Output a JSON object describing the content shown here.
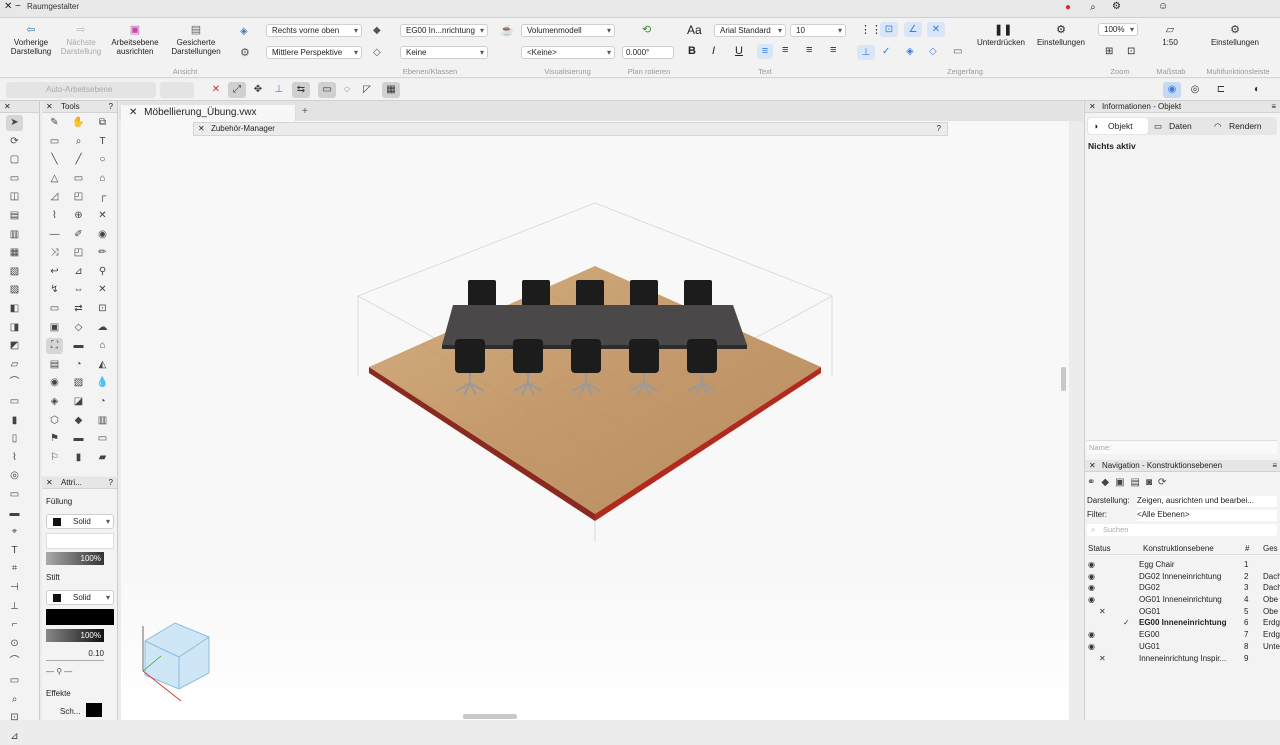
{
  "app_title": "Raumgestalter",
  "window_title": "Möbellierung_Übung.vwx",
  "ribbon": {
    "buttons": [
      {
        "label": "Vorherige Darstellung",
        "icon": "back-arrow-icon"
      },
      {
        "label": "Nächste Darstellung",
        "icon": "forward-arrow-icon"
      },
      {
        "label": "Arbeitsebene ausrichten",
        "icon": "workplane-icon"
      },
      {
        "label": "Gesicherte Darstellungen",
        "icon": "saved-views-icon"
      }
    ],
    "view_select": "Rechts vorne oben",
    "projection_select": "Mittlere Perspektive",
    "layer_select": "EG00 In...nrichtung",
    "class_select": "Keine",
    "render_select": "Volumenmodell",
    "render_sub_select": "<Keine>",
    "rotation_value": "0.000°",
    "font_select": "Arial Standard",
    "font_size": "10",
    "bold": "B",
    "italic": "I",
    "underline": "U",
    "suppress_label": "Unterdrücken",
    "settings_label": "Einstellungen",
    "zoom_value": "100%",
    "scale_value": "1:50",
    "settings_label_2": "Einstellungen",
    "groups": {
      "ansicht": "Ansicht",
      "ebenen": "Ebenen/Klassen",
      "visualisierung": "Visualisierung",
      "plan": "Plan rotieren",
      "text": "Text",
      "zeigerfang": "Zeigerfang",
      "zoom": "Zoom",
      "massstab": "Maßstab",
      "multi": "Multifunktionsleiste"
    },
    "text_prefix": "Aa"
  },
  "toolbar2": {
    "auto_workplane": "Auto-Arbeitsebene"
  },
  "tools_panel": {
    "title": "Tools"
  },
  "attr_panel": {
    "title": "Attri...",
    "fill_label": "Füllung",
    "fill_style": "Solid",
    "fill_opacity": "100%",
    "pen_label": "Stift",
    "pen_style": "Solid",
    "pen_opacity": "100%",
    "line_weight": "0.10",
    "effects_label": "Effekte",
    "effects_value": "Sch..."
  },
  "zubehoer": {
    "title": "Zubehör-Manager",
    "help": "?"
  },
  "info_panel": {
    "title": "Informationen - Objekt",
    "tabs": [
      "Objekt",
      "Daten",
      "Rendern"
    ],
    "status": "Nichts aktiv",
    "name_label": "Name:"
  },
  "nav_panel": {
    "title": "Navigation - Konstruktionsebenen",
    "darstellung_label": "Darstellung:",
    "darstellung_value": "Zeigen, ausrichten und bearbei...",
    "filter_label": "Filter:",
    "filter_value": "<Alle Ebenen>",
    "search_placeholder": "Suchen",
    "columns": [
      "Status",
      "Konstruktionsebene",
      "#",
      "Ges"
    ],
    "rows": [
      {
        "status": "eye",
        "name": "Egg Chair",
        "num": "1",
        "extra": ""
      },
      {
        "status": "eye",
        "name": "DG02 Inneneinrichtung",
        "num": "2",
        "extra": "Dach"
      },
      {
        "status": "eye",
        "name": "DG02",
        "num": "3",
        "extra": "Dach"
      },
      {
        "status": "eye",
        "name": "OG01 Inneneinrichtung",
        "num": "4",
        "extra": "Obe"
      },
      {
        "status": "x",
        "name": "OG01",
        "num": "5",
        "extra": "Obe"
      },
      {
        "status": "check",
        "name": "EG00 Inneneinrichtung",
        "num": "6",
        "extra": "Erdg"
      },
      {
        "status": "eye",
        "name": "EG00",
        "num": "7",
        "extra": "Erdg"
      },
      {
        "status": "eye",
        "name": "UG01",
        "num": "8",
        "extra": "Unte"
      },
      {
        "status": "x",
        "name": "Inneneinrichtung Inspir...",
        "num": "9",
        "extra": ""
      }
    ]
  },
  "colors": {
    "accent": "#3b7ddd",
    "floor": "#c49a6c",
    "floor_edge": "#b22a1e",
    "table": "#4a4848",
    "chair": "#1c1c1c"
  }
}
